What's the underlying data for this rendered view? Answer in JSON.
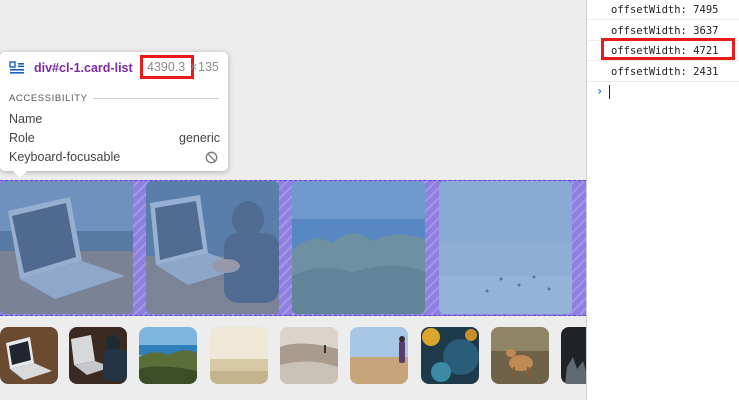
{
  "tooltip": {
    "selector": "div#cl-1.card-list",
    "width": "4390.3",
    "times": "×",
    "height": "135",
    "section_title": "ACCESSIBILITY",
    "rows": [
      {
        "label": "Name",
        "value": ""
      },
      {
        "label": "Role",
        "value": "generic"
      },
      {
        "label": "Keyboard-focusable",
        "value": ""
      }
    ],
    "icons": {
      "element": "grid-layout-icon",
      "focusable": "blocked-icon"
    }
  },
  "console": {
    "logs": [
      "offsetWidth: 7495",
      "offsetWidth: 3637",
      "offsetWidth: 4721",
      "offsetWidth: 2431"
    ],
    "prompt": "›"
  },
  "colors": {
    "highlight_red": "#e81b1b",
    "overlay_purple": "#8f7fe0",
    "selector_purple": "#7b2aa3",
    "prompt_blue": "#1a73e8"
  },
  "cards": [
    {
      "name": "laptop-on-table-card"
    },
    {
      "name": "person-typing-laptop-card"
    },
    {
      "name": "coastal-plants-card"
    },
    {
      "name": "foggy-beach-card"
    }
  ],
  "thumbnails": [
    {
      "name": "laptop-thumb"
    },
    {
      "name": "typing-thumb"
    },
    {
      "name": "coast-thumb"
    },
    {
      "name": "sandy-sky-thumb"
    },
    {
      "name": "beach-walker-thumb"
    },
    {
      "name": "person-on-beach-thumb"
    },
    {
      "name": "moss-closeup-thumb"
    },
    {
      "name": "deer-thumb"
    },
    {
      "name": "dark-thumb"
    }
  ]
}
